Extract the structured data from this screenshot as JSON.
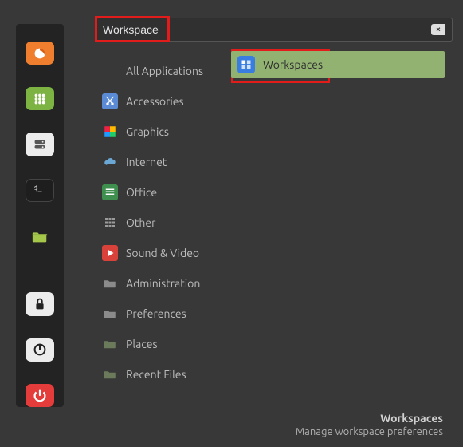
{
  "search": {
    "value": "Workspace"
  },
  "launcher": [
    {
      "name": "firefox",
      "bg": "#ef7f2e"
    },
    {
      "name": "apps-grid",
      "bg": "#7cb342"
    },
    {
      "name": "drives",
      "bg": "#ececec"
    },
    {
      "name": "terminal",
      "bg": "#1e1e1e"
    },
    {
      "name": "files",
      "bg": "#a6c84a"
    },
    {
      "name": "lock",
      "bg": "#ececec"
    },
    {
      "name": "logout",
      "bg": "#ececec"
    },
    {
      "name": "power",
      "bg": "#e43b3b"
    }
  ],
  "categories": [
    {
      "label": "All Applications",
      "icon": "none"
    },
    {
      "label": "Accessories",
      "icon": "scissors"
    },
    {
      "label": "Graphics",
      "icon": "palette"
    },
    {
      "label": "Internet",
      "icon": "cloud"
    },
    {
      "label": "Office",
      "icon": "spreadsheet"
    },
    {
      "label": "Other",
      "icon": "grid"
    },
    {
      "label": "Sound & Video",
      "icon": "play"
    },
    {
      "label": "Administration",
      "icon": "folder"
    },
    {
      "label": "Preferences",
      "icon": "folder"
    },
    {
      "label": "Places",
      "icon": "folder"
    },
    {
      "label": "Recent Files",
      "icon": "folder"
    }
  ],
  "results": [
    {
      "label": "Workspaces",
      "icon": "workspaces"
    }
  ],
  "footer": {
    "title": "Workspaces",
    "subtitle": "Manage workspace preferences"
  },
  "colors": {
    "accent": "#92b272",
    "highlight": "#e21b1b"
  }
}
